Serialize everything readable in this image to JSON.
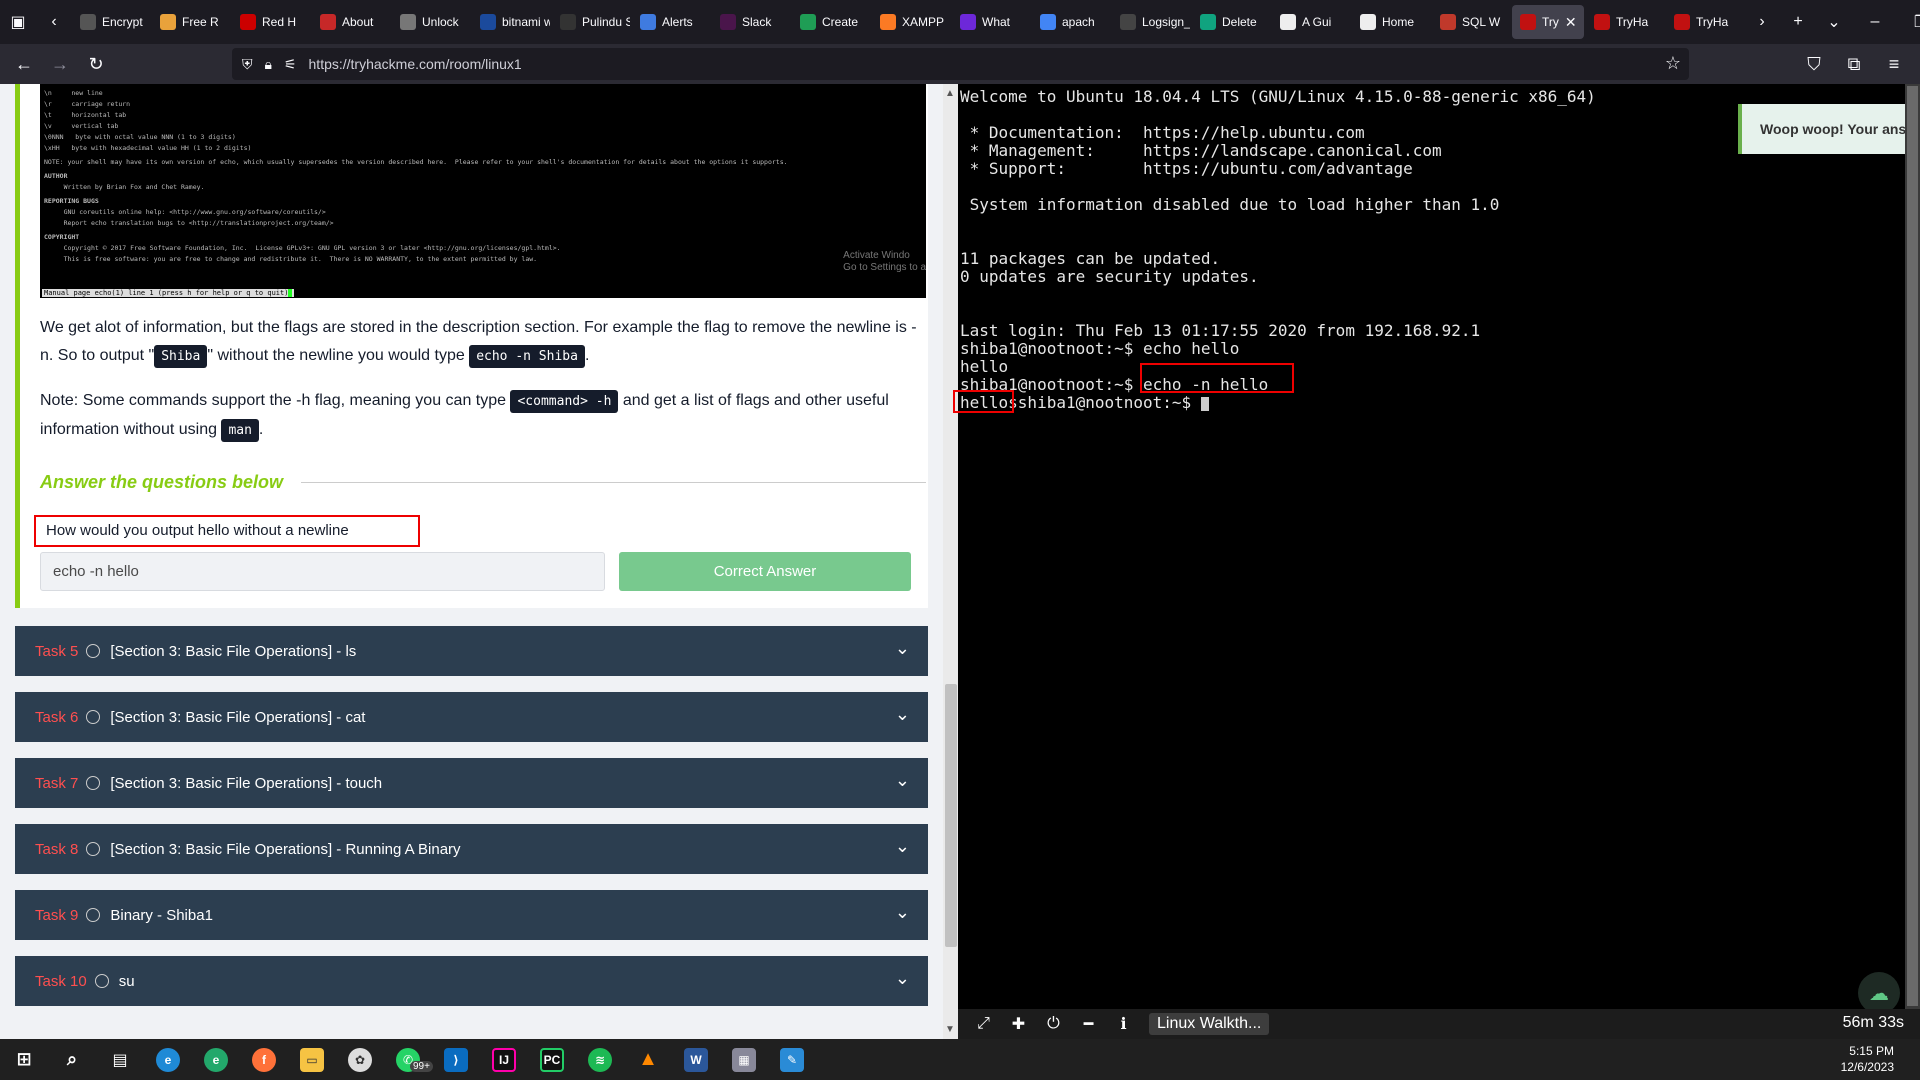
{
  "browser": {
    "tabs": [
      {
        "label": "Encrypt",
        "icon": "tab-icon",
        "color": "#555"
      },
      {
        "label": "Free R",
        "icon": "tab-icon",
        "color": "#e9a23b"
      },
      {
        "label": "Red H",
        "icon": "tab-icon",
        "color": "#cc0000"
      },
      {
        "label": "About",
        "icon": "tab-icon",
        "color": "#c62828"
      },
      {
        "label": "Unlock",
        "icon": "tab-icon",
        "color": "#777"
      },
      {
        "label": "bitnami w",
        "icon": "tab-icon",
        "color": "#1b4a9c"
      },
      {
        "label": "Pulindu Sa",
        "icon": "tab-icon",
        "color": "#333"
      },
      {
        "label": "Alerts",
        "icon": "tab-icon",
        "color": "#3f7be0"
      },
      {
        "label": "Slack",
        "icon": "tab-icon",
        "color": "#4a154b"
      },
      {
        "label": "Create",
        "icon": "tab-icon",
        "color": "#1f9d55"
      },
      {
        "label": "XAMPP",
        "icon": "tab-icon",
        "color": "#fb7a24"
      },
      {
        "label": "What",
        "icon": "tab-icon",
        "color": "#6d28d9"
      },
      {
        "label": "apach",
        "icon": "tab-icon",
        "color": "#4285f4"
      },
      {
        "label": "Logsign_S",
        "icon": "tab-icon",
        "color": "#444"
      },
      {
        "label": "Delete",
        "icon": "tab-icon",
        "color": "#10a37f"
      },
      {
        "label": "A Gui",
        "icon": "tab-icon",
        "color": "#eee"
      },
      {
        "label": "Home",
        "icon": "tab-icon",
        "color": "#eee"
      },
      {
        "label": "SQL W",
        "icon": "tab-icon",
        "color": "#c0392b"
      },
      {
        "label": "Try",
        "icon": "tab-icon",
        "color": "#c11111",
        "active": true
      },
      {
        "label": "TryHa",
        "icon": "tab-icon",
        "color": "#c11111"
      },
      {
        "label": "TryHa",
        "icon": "tab-icon",
        "color": "#c11111"
      }
    ],
    "url": "https://tryhackme.com/room/linux1"
  },
  "man_page": {
    "lines": [
      "\\n     new line",
      "\\r     carriage return",
      "\\t     horizontal tab",
      "\\v     vertical tab",
      "\\0NNN   byte with octal value NNN (1 to 3 digits)",
      "\\xHH   byte with hexadecimal value HH (1 to 2 digits)",
      "NOTE: your shell may have its own version of echo, which usually supersedes the version described here.  Please refer to your shell's documentation for details about the options it supports.",
      "AUTHOR",
      "     Written by Brian Fox and Chet Ramey.",
      "REPORTING BUGS",
      "     GNU coreutils online help: <http://www.gnu.org/software/coreutils/>",
      "     Report echo translation bugs to <http://translationproject.org/team/>",
      "COPYRIGHT",
      "     Copyright © 2017 Free Software Foundation, Inc.  License GPLv3+: GNU GPL version 3 or later <http://gnu.org/licenses/gpl.html>.",
      "     This is free software: you are free to change and redistribute it.  There is NO WARRANTY, to the extent permitted by law."
    ],
    "watermark_1": "Activate Windo",
    "watermark_2": "Go to Settings to a",
    "status": "Manual page echo(1) line 1 (press h for help or q to quit)"
  },
  "content": {
    "p1_a": "We get alot of information, but the flags are stored in the description section. For example the flag to remove the newline is -n. So to output \"",
    "p1_code1": "Shiba",
    "p1_b": "\" without the newline you would type ",
    "p1_code2": "echo -n Shiba",
    "p1_c": ".",
    "p2_a": "Note: Some commands support the -h flag, meaning you can type ",
    "p2_code1": "<command> -h",
    "p2_b": " and get a list of flags and other useful information without using ",
    "p2_code2": "man",
    "p2_c": ".",
    "answer_heading": "Answer the questions below",
    "question": "How would you output hello without a newline",
    "answer_value": "echo -n hello",
    "correct_label": "Correct Answer"
  },
  "tasks": [
    {
      "num": "Task 5",
      "title": "[Section 3: Basic File Operations] - ls"
    },
    {
      "num": "Task 6",
      "title": "[Section 3: Basic File Operations] - cat"
    },
    {
      "num": "Task 7",
      "title": "[Section 3: Basic File Operations] - touch"
    },
    {
      "num": "Task 8",
      "title": "[Section 3: Basic File Operations] - Running A Binary"
    },
    {
      "num": "Task 9",
      "title": "Binary - Shiba1"
    },
    {
      "num": "Task 10",
      "title": "su"
    }
  ],
  "terminal": {
    "lines": [
      "Welcome to Ubuntu 18.04.4 LTS (GNU/Linux 4.15.0-88-generic x86_64)",
      "",
      " * Documentation:  https://help.ubuntu.com",
      " * Management:     https://landscape.canonical.com",
      " * Support:        https://ubuntu.com/advantage",
      "",
      " System information disabled due to load higher than 1.0",
      "",
      "",
      "11 packages can be updated.",
      "0 updates are security updates.",
      "",
      "",
      "Last login: Thu Feb 13 01:17:55 2020 from 192.168.92.1",
      "shiba1@nootnoot:~$ echo hello",
      "hello",
      "shiba1@nootnoot:~$ echo -n hello",
      "hellosshiba1@nootnoot:~$ "
    ],
    "toast": "Woop woop! Your ans",
    "tab_label": "Linux Walkth...",
    "timer": "56m 33s"
  },
  "system": {
    "time": "5:15 PM",
    "date": "12/6/2023",
    "badge": "99+"
  }
}
